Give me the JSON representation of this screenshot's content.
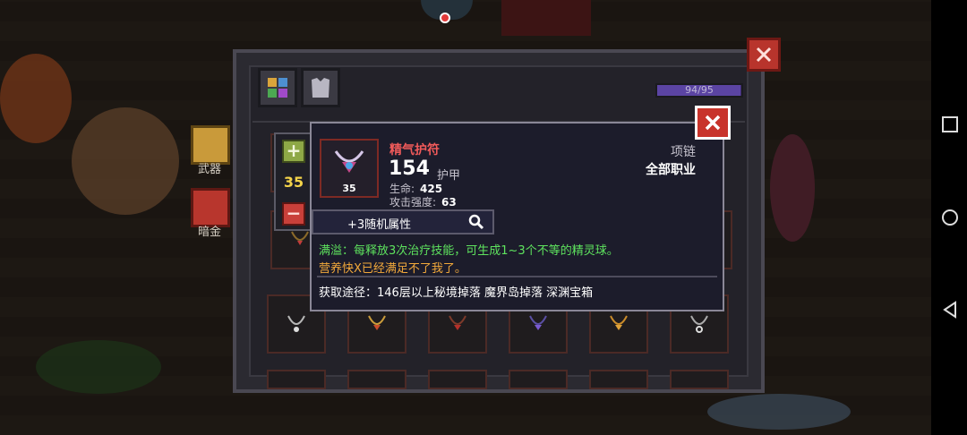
{
  "left_menu": {
    "weapon_label": "武器",
    "gold_label": "暗金"
  },
  "inventory": {
    "capacity": "94/95",
    "capacity_fraction": 0.989
  },
  "stepper": {
    "value": "35",
    "plus_symbol": "+",
    "minus_symbol": "−"
  },
  "tooltip": {
    "item_name": "精气护符",
    "item_level": "35",
    "main_value": "154",
    "main_value_label": "护甲",
    "stats": [
      {
        "label": "生命:",
        "value": "425"
      },
      {
        "label": "攻击强度:",
        "value": "63"
      }
    ],
    "item_type": "项链",
    "item_class": "全部职业",
    "random_attributes": "+3随机属性",
    "effect_green": "满溢：每释放3次治疗技能，可生成1~3个不等的精灵球。",
    "effect_orange": "营养快X已经满足不了我了。",
    "source": "获取途径：146层以上秘境掉落 魔界岛掉落 深渊宝箱"
  },
  "colors": {
    "item_name": "#f05a5a",
    "effect_green": "#5ee35e",
    "effect_orange": "#f2a93b",
    "stepper_value": "#f3d34a"
  }
}
